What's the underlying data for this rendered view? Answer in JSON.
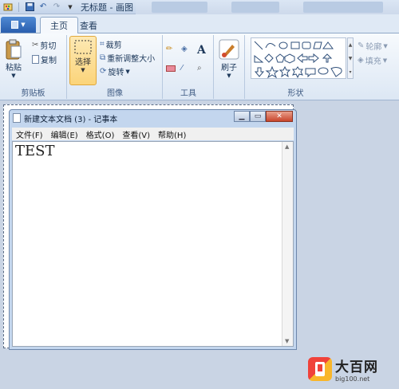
{
  "window": {
    "title": "无标题 - 画图"
  },
  "tabs": {
    "file": "",
    "home": "主页",
    "view": "查看"
  },
  "clipboard": {
    "paste": "粘贴",
    "cut": "剪切",
    "copy": "复制",
    "label": "剪贴板"
  },
  "image_group": {
    "select": "选择",
    "crop": "裁剪",
    "resize": "重新调整大小",
    "rotate": "旋转",
    "label": "图像"
  },
  "tools": {
    "label": "工具"
  },
  "brushes": {
    "label": "刷子"
  },
  "shapes": {
    "outline": "轮廓",
    "fill": "填充",
    "label": "形状"
  },
  "notepad": {
    "title": "新建文本文档 (3) - 记事本",
    "menu": [
      "文件(F)",
      "编辑(E)",
      "格式(O)",
      "查看(V)",
      "帮助(H)"
    ],
    "content": "TEST"
  },
  "watermark": {
    "name": "大百网",
    "url": "big100.net"
  },
  "colors": {
    "accent": "#2a5fae",
    "select_highlight": "#fbd47a"
  },
  "icons": [
    "save-icon",
    "undo-icon",
    "redo-icon",
    "paste-icon",
    "cut-icon",
    "copy-icon",
    "crop-icon",
    "resize-icon",
    "rotate-icon",
    "pencil-icon",
    "fill-icon",
    "text-icon",
    "eraser-icon",
    "color-picker-icon",
    "magnifier-icon",
    "brush-icon"
  ]
}
